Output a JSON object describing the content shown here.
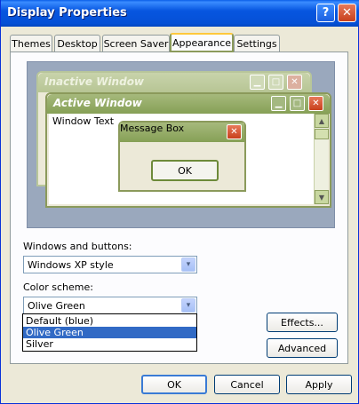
{
  "window": {
    "title": "Display Properties",
    "help_glyph": "?",
    "close_glyph": "✕"
  },
  "tabs": [
    "Themes",
    "Desktop",
    "Screen Saver",
    "Appearance",
    "Settings"
  ],
  "active_tab": "Appearance",
  "preview": {
    "inactive_title": "Inactive Window",
    "active_title": "Active Window",
    "window_text": "Window Text",
    "message_title": "Message Box",
    "ok_label": "OK",
    "min_glyph": "▁",
    "max_glyph": "□",
    "close_glyph": "✕",
    "scroll_up_glyph": "▲",
    "scroll_down_glyph": "▼"
  },
  "windows_buttons": {
    "label": "Windows and buttons:",
    "value": "Windows XP style"
  },
  "color_scheme": {
    "label": "Color scheme:",
    "value": "Olive Green",
    "options": [
      "Default (blue)",
      "Olive Green",
      "Silver"
    ],
    "selected_index": 1
  },
  "buttons": {
    "effects": "Effects...",
    "advanced": "Advanced",
    "ok": "OK",
    "cancel": "Cancel",
    "apply": "Apply"
  },
  "dropdown_arrow_glyph": "▾",
  "colors": {
    "xp_titlebar_blue": "#0553d6",
    "olive_titlebar": "#86a056",
    "selection_blue": "#316ac5",
    "tab_highlight": "#ffc83c"
  }
}
